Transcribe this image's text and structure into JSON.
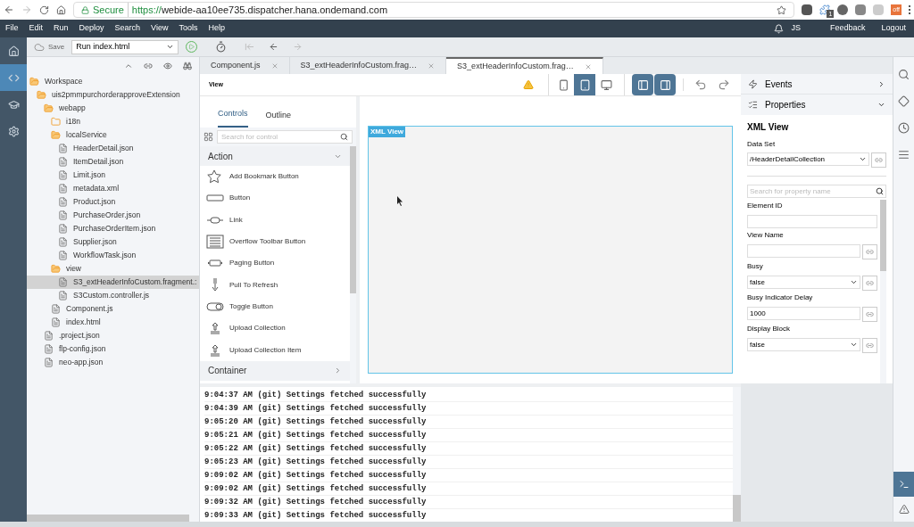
{
  "browser": {
    "secure_label": "Secure",
    "url_scheme": "https://",
    "url_host": "webide-aa10ee735.dispatcher.hana.ondemand.com",
    "ext_badge": "1",
    "ext_badge_off": "off"
  },
  "menu": {
    "items": [
      "File",
      "Edit",
      "Run",
      "Deploy",
      "Search",
      "View",
      "Tools",
      "Help"
    ],
    "user": "JS",
    "links": [
      "Feedback",
      "Logout"
    ]
  },
  "toolbar": {
    "save": "Save",
    "run_config": "Run index.html"
  },
  "rail": [
    {
      "kind": "home",
      "selected": false
    },
    {
      "kind": "code",
      "selected": true
    },
    {
      "kind": "learn",
      "selected": false
    },
    {
      "kind": "settings",
      "selected": false
    }
  ],
  "tree": [
    {
      "label": "Workspace",
      "kind": "folder",
      "expanded": true,
      "selected": false,
      "children": [
        {
          "label": "uis2pmmpurchorderapproveExtension",
          "kind": "folder",
          "expanded": true,
          "selected": false,
          "children": [
            {
              "label": "webapp",
              "kind": "folder",
              "expanded": true,
              "selected": false,
              "children": [
                {
                  "label": "i18n",
                  "kind": "folder",
                  "expanded": false,
                  "selected": false
                },
                {
                  "label": "localService",
                  "kind": "folder",
                  "expanded": true,
                  "selected": false,
                  "children": [
                    {
                      "label": "HeaderDetail.json",
                      "kind": "file",
                      "selected": false
                    },
                    {
                      "label": "ItemDetail.json",
                      "kind": "file",
                      "selected": false
                    },
                    {
                      "label": "Limit.json",
                      "kind": "file",
                      "selected": false
                    },
                    {
                      "label": "metadata.xml",
                      "kind": "file",
                      "selected": false
                    },
                    {
                      "label": "Product.json",
                      "kind": "file",
                      "selected": false
                    },
                    {
                      "label": "PurchaseOrder.json",
                      "kind": "file",
                      "selected": false
                    },
                    {
                      "label": "PurchaseOrderItem.json",
                      "kind": "file",
                      "selected": false
                    },
                    {
                      "label": "Supplier.json",
                      "kind": "file",
                      "selected": false
                    },
                    {
                      "label": "WorkflowTask.json",
                      "kind": "file",
                      "selected": false
                    }
                  ]
                },
                {
                  "label": "view",
                  "kind": "folder",
                  "expanded": true,
                  "selected": false,
                  "children": [
                    {
                      "label": "S3_extHeaderInfoCustom.fragment.:",
                      "kind": "file",
                      "selected": true
                    },
                    {
                      "label": "S3Custom.controller.js",
                      "kind": "file",
                      "selected": false
                    }
                  ]
                },
                {
                  "label": "Component.js",
                  "kind": "file",
                  "selected": false
                },
                {
                  "label": "index.html",
                  "kind": "file",
                  "selected": false
                }
              ]
            },
            {
              "label": ".project.json",
              "kind": "file",
              "selected": false
            },
            {
              "label": "flp-config.json",
              "kind": "file",
              "selected": false
            },
            {
              "label": "neo-app.json",
              "kind": "file",
              "selected": false
            }
          ]
        }
      ]
    }
  ],
  "tabs": [
    {
      "label": "Component.js",
      "selected": false
    },
    {
      "label": "S3_extHeaderInfoCustom.frag…",
      "selected": false
    },
    {
      "label": "S3_extHeaderInfoCustom.frag…",
      "selected": true
    }
  ],
  "editor": {
    "title": "View",
    "devices": [
      {
        "kind": "phone",
        "selected": false
      },
      {
        "kind": "tablet",
        "selected": true
      },
      {
        "kind": "desktop",
        "selected": false
      }
    ],
    "panels": [
      {
        "kind": "left",
        "selected": true
      },
      {
        "kind": "right",
        "selected": true
      }
    ]
  },
  "palette": {
    "tabs": [
      {
        "label": "Controls",
        "selected": true
      },
      {
        "label": "Outline",
        "selected": false
      }
    ],
    "search_placeholder": "Search for control",
    "sections": [
      {
        "title": "Action",
        "expanded": true,
        "items": [
          {
            "label": "Add Bookmark Button",
            "kind": "bookmark"
          },
          {
            "label": "Button",
            "kind": "button"
          },
          {
            "label": "Link",
            "kind": "link"
          },
          {
            "label": "Overflow Toolbar Button",
            "kind": "overflow"
          },
          {
            "label": "Paging Button",
            "kind": "paging"
          },
          {
            "label": "Pull To Refresh",
            "kind": "refresh"
          },
          {
            "label": "Toggle Button",
            "kind": "toggle"
          },
          {
            "label": "Upload Collection",
            "kind": "upload"
          },
          {
            "label": "Upload Collection Item",
            "kind": "upload"
          }
        ]
      },
      {
        "title": "Container",
        "expanded": false
      }
    ]
  },
  "canvas": {
    "label": "XML View"
  },
  "properties": {
    "events_title": "Events",
    "events_expanded": false,
    "title": "Properties",
    "expanded": true,
    "control": "XML View",
    "data_set_label": "Data Set",
    "data_set": "/HeaderDetailCollection",
    "search_placeholder": "Search for property name",
    "fields": [
      {
        "label": "Element ID",
        "kind": "text",
        "binding": false
      },
      {
        "label": "View Name",
        "kind": "text",
        "binding": true
      },
      {
        "label": "Busy",
        "kind": "select",
        "value": "false",
        "binding": true
      },
      {
        "label": "Busy Indicator Delay",
        "kind": "text",
        "value": "1000",
        "binding": true
      },
      {
        "label": "Display Block",
        "kind": "select",
        "value": "false",
        "binding": true
      }
    ]
  },
  "console": [
    "9:04:37 AM (git) Settings fetched successfully",
    "9:04:39 AM (git) Settings fetched successfully",
    "9:05:20 AM (git) Settings fetched successfully",
    "9:05:21 AM (git) Settings fetched successfully",
    "9:05:22 AM (git) Settings fetched successfully",
    "9:05:23 AM (git) Settings fetched successfully",
    "9:09:02 AM (git) Settings fetched successfully",
    "9:09:02 AM (git) Settings fetched successfully",
    "9:09:32 AM (git) Settings fetched successfully",
    "9:09:33 AM (git) Settings fetched successfully"
  ],
  "right_rail": [
    {
      "kind": "search",
      "selected": false
    },
    {
      "kind": "git",
      "selected": false
    },
    {
      "kind": "history",
      "selected": false
    },
    {
      "kind": "outline",
      "selected": false
    }
  ],
  "right_rail_bottom": [
    {
      "kind": "console",
      "selected": true
    },
    {
      "kind": "problems",
      "selected": false
    }
  ]
}
